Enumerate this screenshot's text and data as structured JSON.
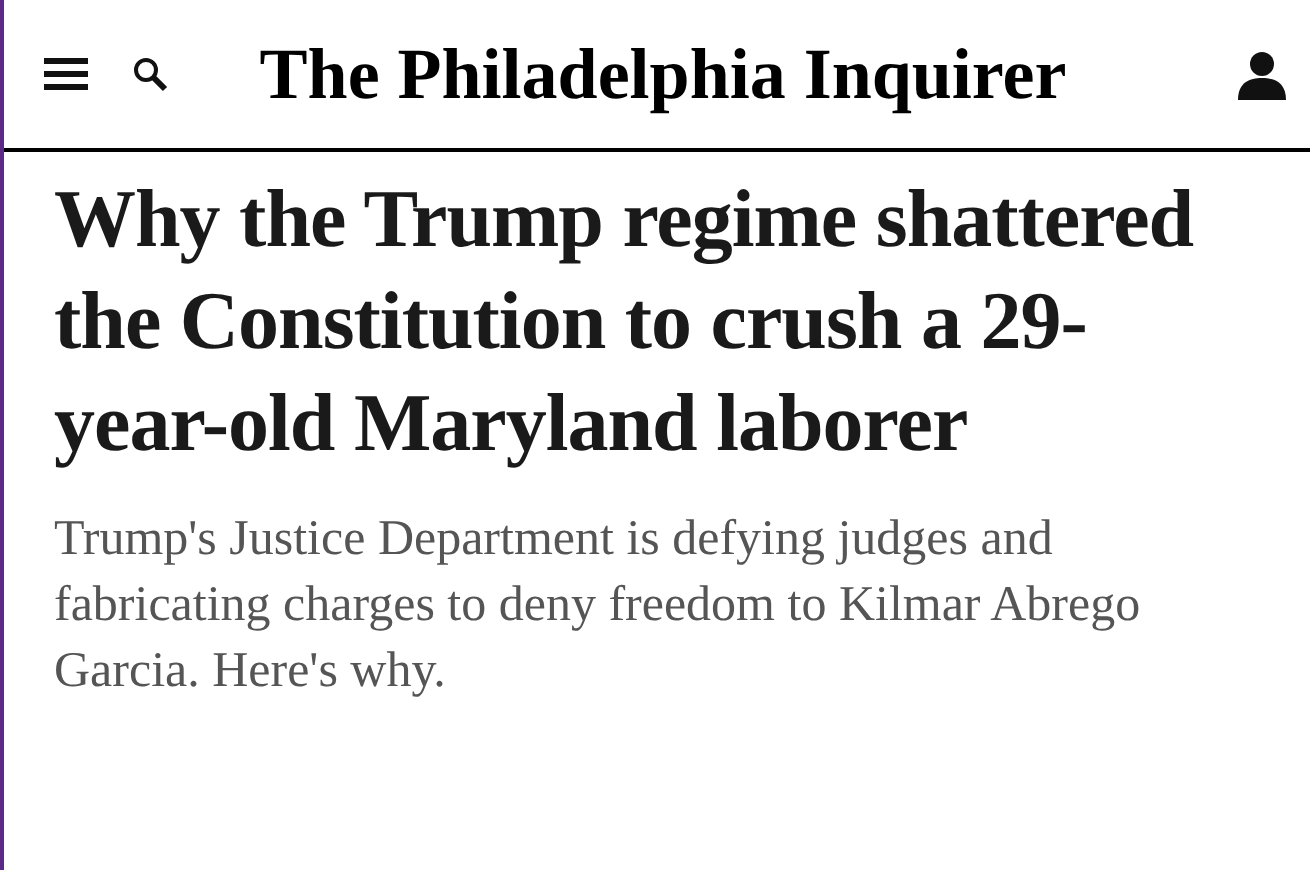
{
  "header": {
    "logo": "The Philadelphia Inquirer"
  },
  "article": {
    "headline": "Why the Trump regime shattered the Constitution to crush a 29-year-old Maryland laborer",
    "dek": "Trump's Justice Department is defying judges and fabricating charges to deny freedom to Kilmar Abrego Garcia. Here's why."
  }
}
